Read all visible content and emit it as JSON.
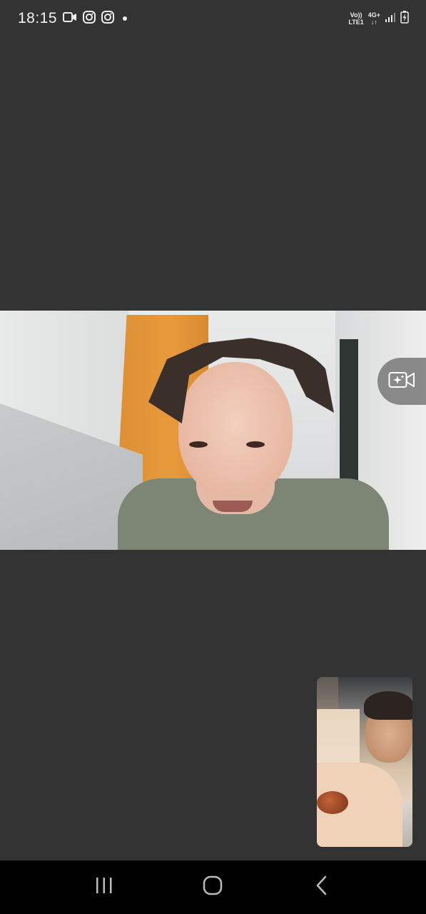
{
  "status_bar": {
    "time": "18:15",
    "left_icons": [
      "video-call-icon",
      "instagram-icon",
      "instagram-icon",
      "notification-dot-icon"
    ],
    "network_top": "Vo))",
    "network_bottom": "LTE1",
    "network_type": "4G+",
    "signal_icon": "signal-icon",
    "battery_icon": "battery-charging-icon"
  },
  "call": {
    "remote_video_label": "remote-participant-video",
    "effects_icon": "camera-effects-icon",
    "self_preview_label": "self-camera-preview"
  },
  "nav_bar": {
    "recent_icon": "recent-apps-icon",
    "home_icon": "home-icon",
    "back_icon": "back-icon"
  }
}
